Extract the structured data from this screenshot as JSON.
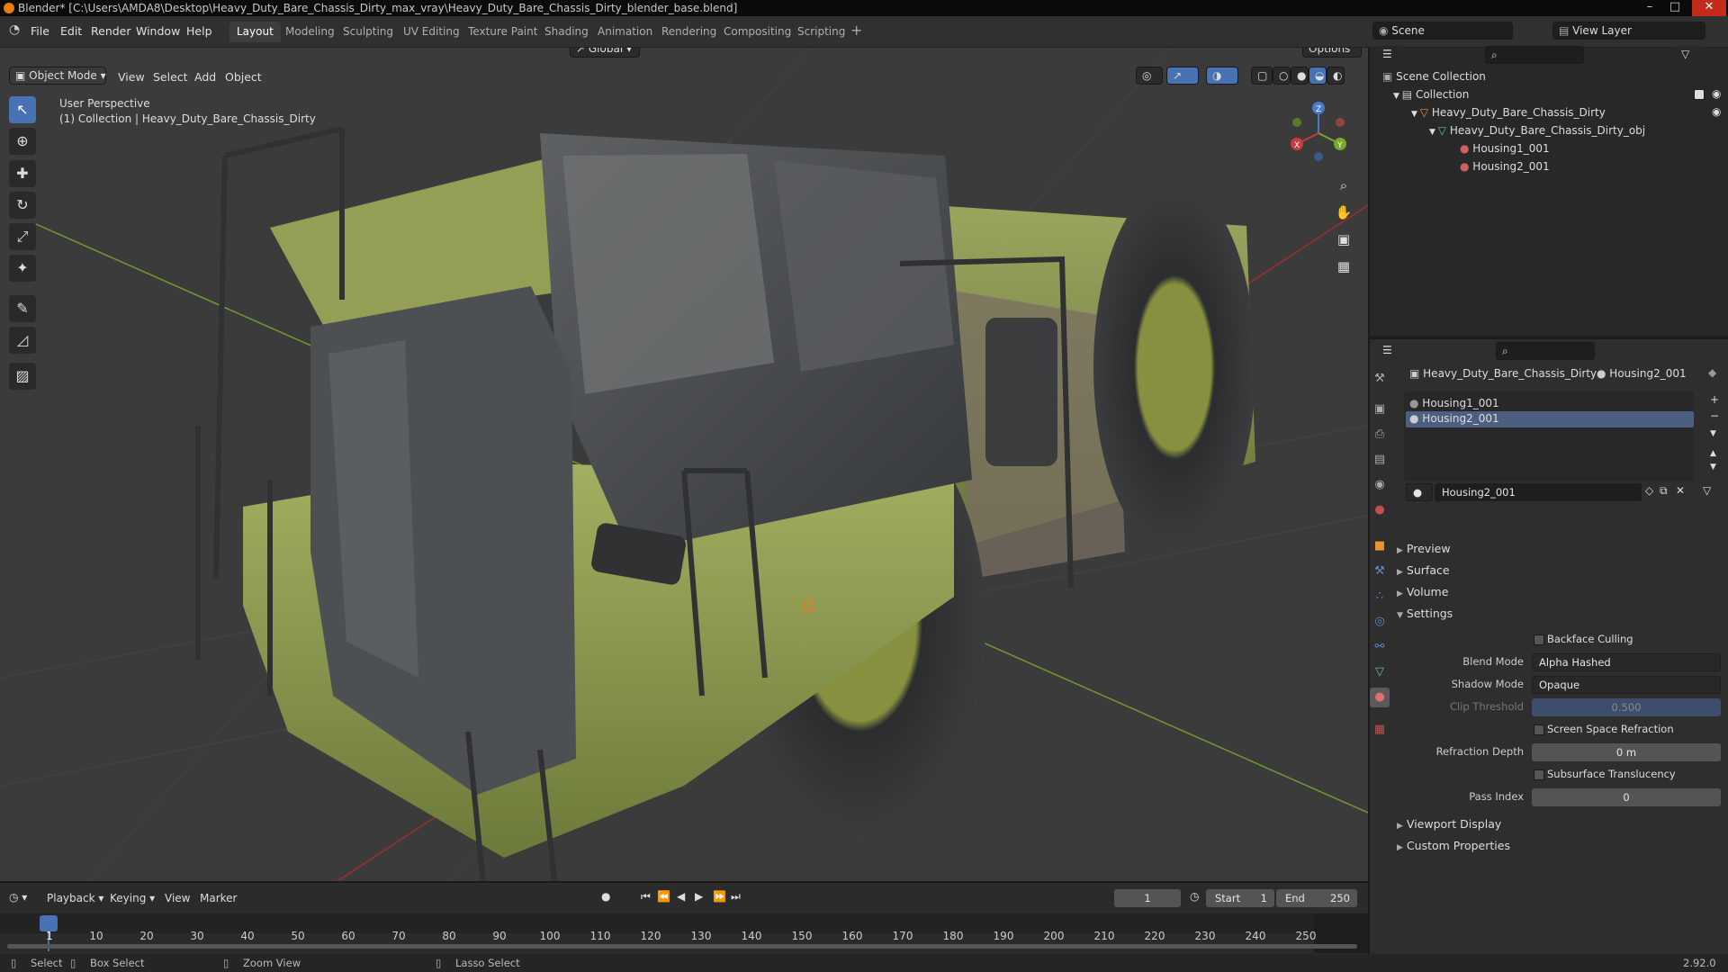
{
  "window": {
    "title": "Blender* [C:\\Users\\AMDA8\\Desktop\\Heavy_Duty_Bare_Chassis_Dirty_max_vray\\Heavy_Duty_Bare_Chassis_Dirty_blender_base.blend]"
  },
  "menu": [
    "File",
    "Edit",
    "Render",
    "Window",
    "Help"
  ],
  "workspaces": [
    "Layout",
    "Modeling",
    "Sculpting",
    "UV Editing",
    "Texture Paint",
    "Shading",
    "Animation",
    "Rendering",
    "Compositing",
    "Scripting"
  ],
  "scene": {
    "name": "Scene",
    "view_layer": "View Layer"
  },
  "viewport": {
    "mode": "Object Mode",
    "menus": [
      "View",
      "Select",
      "Add",
      "Object"
    ],
    "transform_orientation": "Global",
    "options": "Options",
    "overlay_title": "User Perspective",
    "overlay_subtitle": "(1) Collection | Heavy_Duty_Bare_Chassis_Dirty",
    "gizmo": {
      "x": "X",
      "y": "Y",
      "z": "Z"
    }
  },
  "outliner": {
    "root": "Scene Collection",
    "collection": "Collection",
    "object": "Heavy_Duty_Bare_Chassis_Dirty",
    "mesh": "Heavy_Duty_Bare_Chassis_Dirty_obj",
    "materials": [
      "Housing1_001",
      "Housing2_001"
    ]
  },
  "properties": {
    "breadcrumb_object": "Heavy_Duty_Bare_Chassis_Dirty",
    "breadcrumb_material": "Housing2_001",
    "slots": [
      "Housing1_001",
      "Housing2_001"
    ],
    "material_name": "Housing2_001",
    "sections": {
      "preview": "Preview",
      "surface": "Surface",
      "volume": "Volume",
      "settings": "Settings",
      "viewport_display": "Viewport Display",
      "custom_properties": "Custom Properties"
    },
    "backface_culling": "Backface Culling",
    "blend_mode_label": "Blend Mode",
    "blend_mode": "Alpha Hashed",
    "shadow_mode_label": "Shadow Mode",
    "shadow_mode": "Opaque",
    "clip_threshold_label": "Clip Threshold",
    "clip_threshold": "0.500",
    "ssr": "Screen Space Refraction",
    "refraction_depth_label": "Refraction Depth",
    "refraction_depth": "0 m",
    "subsurface": "Subsurface Translucency",
    "pass_index_label": "Pass Index",
    "pass_index": "0"
  },
  "timeline": {
    "menus": [
      "Playback",
      "Keying",
      "View",
      "Marker"
    ],
    "current_frame": "1",
    "start_label": "Start",
    "start": "1",
    "end_label": "End",
    "end": "250",
    "ticks": [
      "1",
      "10",
      "20",
      "30",
      "40",
      "50",
      "60",
      "70",
      "80",
      "90",
      "100",
      "110",
      "120",
      "130",
      "140",
      "150",
      "160",
      "170",
      "180",
      "190",
      "200",
      "210",
      "220",
      "230",
      "240",
      "250"
    ]
  },
  "status": {
    "select": "Select",
    "box_select": "Box Select",
    "zoom_view": "Zoom View",
    "lasso_select": "Lasso Select",
    "version": "2.92.0"
  },
  "colors": {
    "accent": "#4772b3",
    "header": "#303030",
    "viewport": "#3b3b3b",
    "truck_body": "#8a9a4a",
    "cab": "#4a4d4f"
  }
}
